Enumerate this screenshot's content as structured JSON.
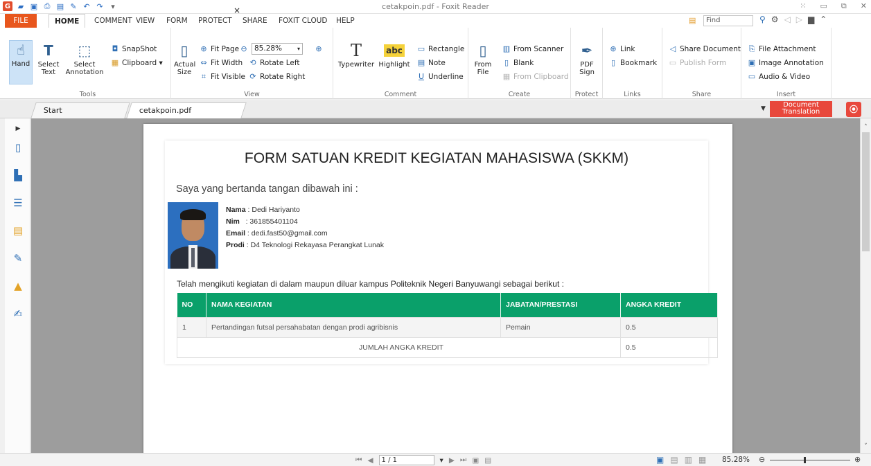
{
  "window": {
    "title": "cetakpoin.pdf - Foxit Reader"
  },
  "quick_access": [
    "app-icon",
    "open-icon",
    "save-icon",
    "print-icon",
    "properties-icon",
    "new-icon",
    "undo-icon",
    "redo-icon",
    "customize-icon"
  ],
  "menu": {
    "file": "FILE",
    "tabs": [
      "HOME",
      "COMMENT",
      "VIEW",
      "FORM",
      "PROTECT",
      "SHARE",
      "FOXIT CLOUD",
      "HELP"
    ],
    "active": "HOME",
    "find_placeholder": "Find"
  },
  "ribbon": {
    "tools": {
      "label": "Tools",
      "hand": "Hand",
      "select_text_1": "Select",
      "select_text_2": "Text",
      "select_annot_1": "Select",
      "select_annot_2": "Annotation",
      "snapshot": "SnapShot",
      "clipboard": "Clipboard"
    },
    "view": {
      "label": "View",
      "actual_1": "Actual",
      "actual_2": "Size",
      "fit_page": "Fit Page",
      "fit_width": "Fit Width",
      "fit_visible": "Fit Visible",
      "rotate_left": "Rotate Left",
      "rotate_right": "Rotate Right",
      "zoom_value": "85.28%"
    },
    "comment": {
      "label": "Comment",
      "typewriter": "Typewriter",
      "highlight": "Highlight",
      "rectangle": "Rectangle",
      "note": "Note",
      "underline": "Underline"
    },
    "create": {
      "label": "Create",
      "from_file_1": "From",
      "from_file_2": "File",
      "from_scanner": "From Scanner",
      "blank": "Blank",
      "from_clipboard": "From Clipboard"
    },
    "protect": {
      "label": "Protect",
      "pdf_sign_1": "PDF",
      "pdf_sign_2": "Sign"
    },
    "links": {
      "label": "Links",
      "link": "Link",
      "bookmark": "Bookmark"
    },
    "share": {
      "label": "Share",
      "share_document": "Share Document",
      "publish_form": "Publish Form"
    },
    "insert": {
      "label": "Insert",
      "file_attachment": "File Attachment",
      "image_annotation": "Image Annotation",
      "audio_video": "Audio & Video"
    }
  },
  "doc_tabs": {
    "start": "Start",
    "current": "cetakpoin.pdf",
    "close": "×"
  },
  "translation": {
    "line1": "Document",
    "line2": "Translation"
  },
  "document": {
    "title": "FORM SATUAN KREDIT KEGIATAN MAHASISWA (SKKM)",
    "intro": "Saya yang bertanda tangan dibawah ini :",
    "bio": {
      "nama_label": "Nama",
      "nama": " : Dedi Hariyanto",
      "nim_label": "Nim",
      "nim": "   : 361855401104",
      "email_label": "Email",
      "email": " : dedi.fast50@gmail.com",
      "prodi_label": "Prodi",
      "prodi": " : D4 Teknologi Rekayasa Perangkat Lunak"
    },
    "lead": "Telah mengikuti kegiatan di dalam maupun diluar kampus Politeknik Negeri Banyuwangi sebagai berikut :",
    "table": {
      "headers": [
        "NO",
        "NAMA KEGIATAN",
        "JABATAN/PRESTASI",
        "ANGKA KREDIT"
      ],
      "rows": [
        [
          "1",
          "Pertandingan futsal persahabatan dengan prodi agribisnis",
          "Pemain",
          "0.5"
        ]
      ],
      "total_label": "JUMLAH ANGKA KREDIT",
      "total_value": "0.5"
    }
  },
  "status": {
    "page": "1 / 1",
    "zoom": "85.28%"
  }
}
